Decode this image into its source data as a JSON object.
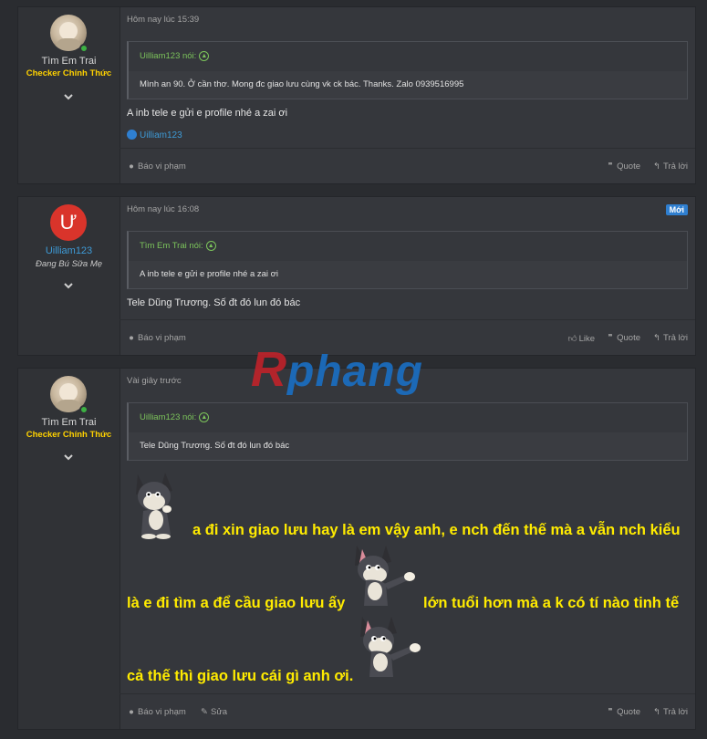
{
  "posts": [
    {
      "user": {
        "name": "Tìm Em Trai",
        "title": "Checker Chính Thức",
        "avatar": "photo-avatar"
      },
      "time": "Hôm nay lúc 15:39",
      "quote": {
        "author": "Uilliam123 nói:",
        "text": "Mình an 90. Ở cần thơ. Mong đc giao lưu cùng vk ck bác. Thanks. Zalo 0939516995"
      },
      "message": "A inb tele e gửi e profile nhé a zai ơi",
      "reaction": "Uilliam123",
      "footer": {
        "report": "Báo vi phạm",
        "quote": "Quote",
        "reply": "Trả lời"
      }
    },
    {
      "user": {
        "name": "Uilliam123",
        "title": "Đang Bú Sữa Mẹ",
        "avatar_letter": "Ư"
      },
      "time": "Hôm nay lúc 16:08",
      "badge": "Mới",
      "quote": {
        "author": "Tìm Em Trai nói:",
        "text": "A inb tele e gửi e profile nhé a zai ơi"
      },
      "message": "Tele Dũng Trương. Số đt đó lun đó bác",
      "footer": {
        "report": "Báo vi phạm",
        "like": "Like",
        "quote": "Quote",
        "reply": "Trả lời"
      }
    },
    {
      "user": {
        "name": "Tìm Em Trai",
        "title": "Checker Chính Thức",
        "avatar": "photo-avatar"
      },
      "time": "Vài giây trước",
      "quote": {
        "author": "Uilliam123 nói:",
        "text": "Tele Dũng Trương. Số đt đó lun đó bác"
      },
      "lines": [
        "a đi xin giao lưu hay là em vậy anh, e nch đến thế mà a vẫn nch kiểu",
        "là e đi tìm a để cầu giao lưu ấy",
        "lớn tuổi hơn mà a k có tí nào tinh tế",
        "cả thế thì giao lưu cái gì anh ơi."
      ],
      "stickers": [
        "tom-cat-sticker",
        "tom-cat-pointing-sticker",
        "tom-cat-pointing-sticker"
      ],
      "footer": {
        "report": "Báo vi phạm",
        "edit": "Sửa",
        "quote": "Quote",
        "reply": "Trả lời"
      }
    }
  ],
  "watermark": "Rphang"
}
